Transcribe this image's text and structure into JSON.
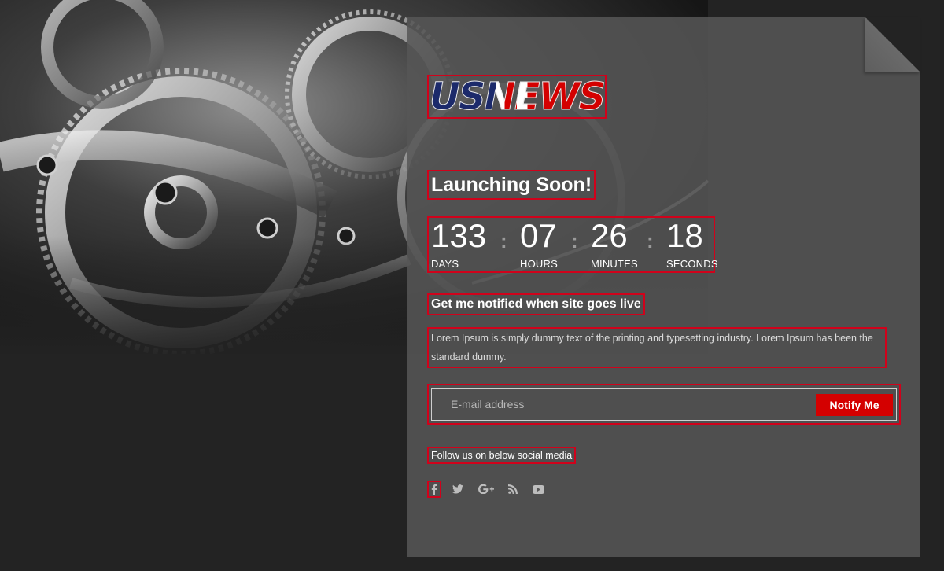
{
  "brand": {
    "logo_text": "USNEWS"
  },
  "hero": {
    "heading": "Launching Soon!",
    "countdown": [
      {
        "value": "133",
        "label": "DAYS"
      },
      {
        "value": "07",
        "label": "HOURS"
      },
      {
        "value": "26",
        "label": "MINUTES"
      },
      {
        "value": "18",
        "label": "SECONDS"
      }
    ],
    "separator": ":"
  },
  "notify": {
    "heading": "Get me notified when site goes live",
    "description": "Lorem Ipsum is simply dummy text of the printing and typesetting industry. Lorem Ipsum has been the standard dummy.",
    "email_placeholder": "E-mail address",
    "button_label": "Notify Me"
  },
  "social": {
    "heading": "Follow us on below social media",
    "icons": [
      "facebook-icon",
      "twitter-icon",
      "google-plus-icon",
      "rss-icon",
      "youtube-icon"
    ]
  },
  "colors": {
    "accent": "#d40000",
    "page_bg": "#232323",
    "card_bg": "#565656"
  }
}
